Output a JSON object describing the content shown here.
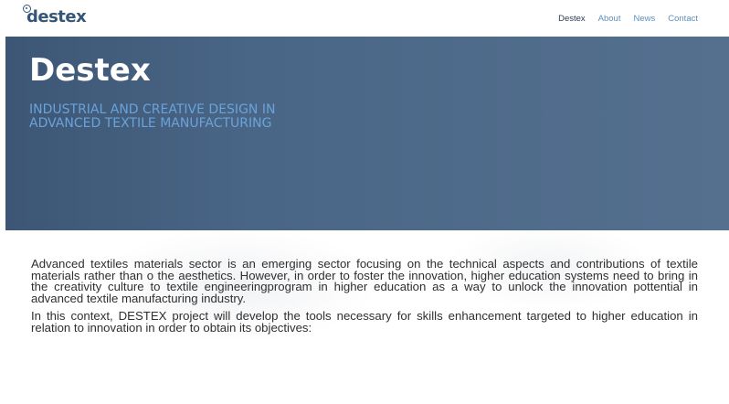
{
  "header": {
    "logo_text": "destex",
    "nav": [
      {
        "label": "Destex",
        "active": true
      },
      {
        "label": "About",
        "active": false
      },
      {
        "label": "News",
        "active": false
      },
      {
        "label": "Contact",
        "active": false
      }
    ]
  },
  "hero": {
    "title": "Destex",
    "subtitle": "INDUSTRIAL AND CREATIVE DESIGN IN ADVANCED TEXTILE MANUFACTURING"
  },
  "content": {
    "paragraph_1": "Advanced textiles materials sector is an emerging sector focusing on the technical aspects and contributions of textile materials rather than o the aesthetics. However, in order to foster the innovation, higher education systems need to bring in the creativity culture to textile engineeringprogram in higher education as a way to unlock the innovation pottential in advanced textile manufacturing industry.",
    "paragraph_2": "In this context, DESTEX project will develop the tools necessary for skills enhancement targeted to higher education in relation to innovation in order to obtain its objectives:"
  },
  "colors": {
    "hero_bg": "#4a6686",
    "hero_subtitle": "#6aa3d9",
    "nav_link": "#5e8fc0",
    "logo": "#355678"
  },
  "icons": {
    "logo_mark": "circle-logo-icon"
  }
}
